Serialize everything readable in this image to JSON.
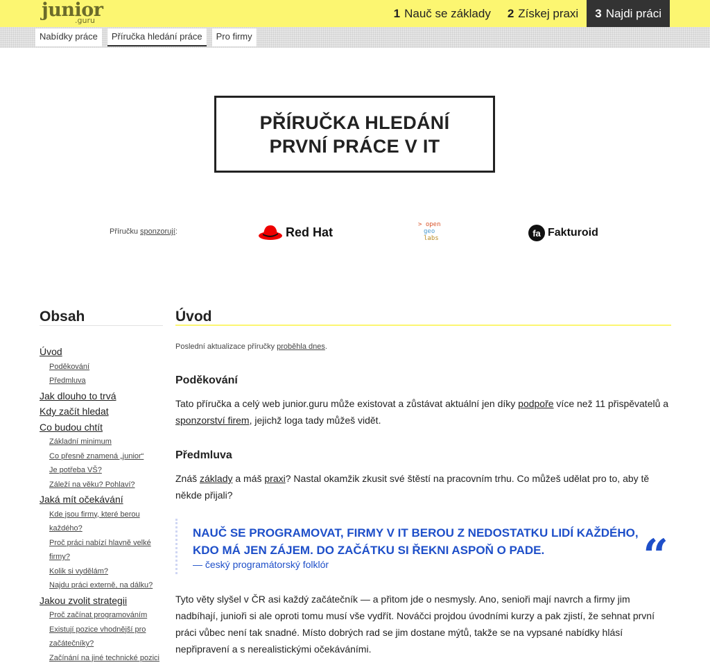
{
  "logo": {
    "main": "junior",
    "sub": ".guru"
  },
  "main_nav": [
    {
      "num": "1",
      "label": "Nauč se základy",
      "active": false
    },
    {
      "num": "2",
      "label": "Získej praxi",
      "active": false
    },
    {
      "num": "3",
      "label": "Najdi práci",
      "active": true
    }
  ],
  "sub_nav": [
    {
      "label": "Nabídky práce",
      "active": false
    },
    {
      "label": "Příručka hledání práce",
      "active": true
    },
    {
      "label": "Pro firmy",
      "active": false
    }
  ],
  "hero": {
    "line1": "PŘÍRUČKA HLEDÁNÍ",
    "line2": "PRVNÍ PRÁCE V IT"
  },
  "sponsors": {
    "label_prefix": "Příručku ",
    "label_link": "sponzorují",
    "label_suffix": ":",
    "redhat": "Red Hat",
    "ogl": [
      "> open",
      "geo",
      "labs"
    ],
    "fakturoid": "Fakturoid",
    "colors": {
      "redhat": "#ee0000",
      "ogl_open": "#d9542b",
      "ogl_geo": "#4b9bd1",
      "ogl_labs": "#b98a23"
    }
  },
  "toc": {
    "title": "Obsah",
    "items": [
      {
        "level": 1,
        "label": "Úvod"
      },
      {
        "level": 2,
        "label": "Poděkování"
      },
      {
        "level": 2,
        "label": "Předmluva"
      },
      {
        "level": 1,
        "label": "Jak dlouho to trvá"
      },
      {
        "level": 1,
        "label": "Kdy začít hledat"
      },
      {
        "level": 1,
        "label": "Co budou chtít"
      },
      {
        "level": 2,
        "label": "Základní minimum"
      },
      {
        "level": 2,
        "label": "Co přesně znamená „junior“"
      },
      {
        "level": 2,
        "label": "Je potřeba VŠ?"
      },
      {
        "level": 2,
        "label": "Záleží na věku? Pohlaví?"
      },
      {
        "level": 1,
        "label": "Jaká mít očekávání"
      },
      {
        "level": 2,
        "label": "Kde jsou firmy, které berou"
      },
      {
        "level": 2,
        "label": "každého?"
      },
      {
        "level": 2,
        "label": "Proč práci nabízí hlavně velké"
      },
      {
        "level": 2,
        "label": "firmy?"
      },
      {
        "level": 2,
        "label": "Kolik si vydělám?"
      },
      {
        "level": 2,
        "label": "Najdu práci externě, na dálku?"
      },
      {
        "level": 1,
        "label": "Jakou zvolit strategii"
      },
      {
        "level": 2,
        "label": "Proč začínat programováním"
      },
      {
        "level": 2,
        "label": "Existují pozice vhodnější pro"
      },
      {
        "level": 2,
        "label": "začátečníky?"
      },
      {
        "level": 2,
        "label": "Začínání na jiné technické pozici"
      }
    ]
  },
  "content": {
    "title": "Úvod",
    "updated_prefix": "Poslední aktualizace příručky ",
    "updated_link": "proběhla dnes",
    "updated_suffix": ".",
    "thanks_heading": "Poděkování",
    "thanks_p1": "Tato příručka a celý web junior.guru může existovat a zůstávat aktuální jen díky ",
    "thanks_link1": "podpoře",
    "thanks_p2": " více než 11 přispěvatelů a ",
    "thanks_link2": "sponzorství firem",
    "thanks_p3": ", jejichž loga tady můžeš vidět.",
    "preface_heading": "Předmluva",
    "preface_p1": "Znáš ",
    "preface_link1": "základy",
    "preface_p2": " a máš ",
    "preface_link2": "praxi",
    "preface_p3": "? Nastal okamžik zkusit své štěstí na pracovním trhu. Co můžeš udělat pro to, aby tě někde přijali?",
    "quote_text": "NAUČ SE PROGRAMOVAT, FIRMY V IT BEROU Z NEDOSTATKU LIDÍ KAŽDÉHO, KDO MÁ JEN ZÁJEM. DO ZAČÁTKU SI ŘEKNI ASPOŇ O PADE.",
    "quote_author": "— český programátorský folklór",
    "quote_mark": "“",
    "closing": "Tyto věty slyšel v ČR asi každý začátečník — a přitom jde o nesmysly. Ano, senioři mají navrch a firmy jim nadbíhají, junioři si ale oproti tomu musí vše vydřít. Nováčci projdou úvodními kurzy a pak zjistí, že sehnat první práci vůbec není tak snadné. Místo dobrých rad se jim dostane mýtů, takže se na vypsané nabídky hlásí nepřipravení a s nerealistickými očekáváními."
  },
  "colors": {
    "topbar": "#fcf671",
    "accent_blue": "#1e4fc9",
    "active_nav": "#333333"
  }
}
